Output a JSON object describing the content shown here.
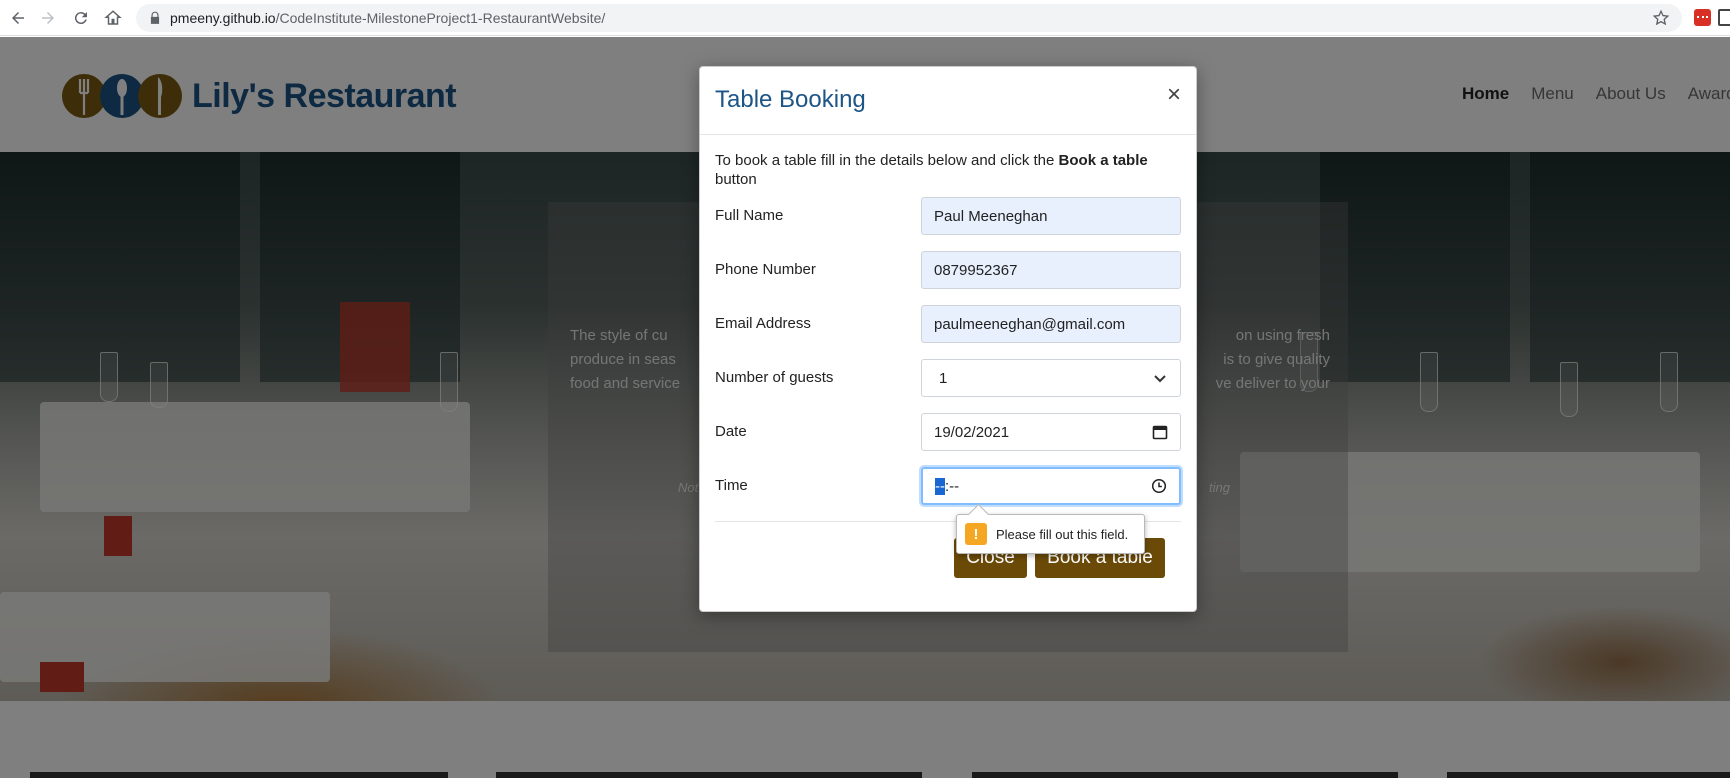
{
  "browser": {
    "url_host": "pmeeny.github.io",
    "url_path": "/CodeInstitute-MilestoneProject1-RestaurantWebsite/"
  },
  "site": {
    "brand": "Lily's Restaurant",
    "nav": [
      "Home",
      "Menu",
      "About Us",
      "Award"
    ],
    "hero_text": "The style of cu… on using fresh produce in seaso… is to give quality food and service… ve deliver to your",
    "hero_line1_left": "The style of cu",
    "hero_line1_right": "on using fresh",
    "hero_line2_left": "produce in seas",
    "hero_line2_right": "is to give quality",
    "hero_line3_left": "food and service",
    "hero_line3_right": "ve deliver to your",
    "hero_note_left": "Not",
    "hero_note_right": "ting"
  },
  "modal": {
    "title": "Table Booking",
    "close_glyph": "×",
    "intro_prefix": "To book a table fill in the details below and click the ",
    "intro_bold": "Book a table",
    "intro_suffix": " button",
    "fields": [
      {
        "label": "Full Name",
        "value": "Paul Meeneghan"
      },
      {
        "label": "Phone Number",
        "value": "0879952367"
      },
      {
        "label": "Email Address",
        "value": "paulmeeneghan@gmail.com"
      },
      {
        "label": "Number of guests",
        "value": "1"
      },
      {
        "label": "Date",
        "value": "19/02/2021"
      },
      {
        "label": "Time",
        "value_hl": "--",
        "value_rest": ":--"
      }
    ],
    "close_button": "Close",
    "book_button": "Book a table",
    "validation_message": "Please fill out this field.",
    "validation_icon": "!"
  },
  "colors": {
    "brand_blue": "#1c5586",
    "button_brown": "#6b4a07",
    "autofill_bg": "#e8f0fe",
    "warning": "#f5a623"
  }
}
